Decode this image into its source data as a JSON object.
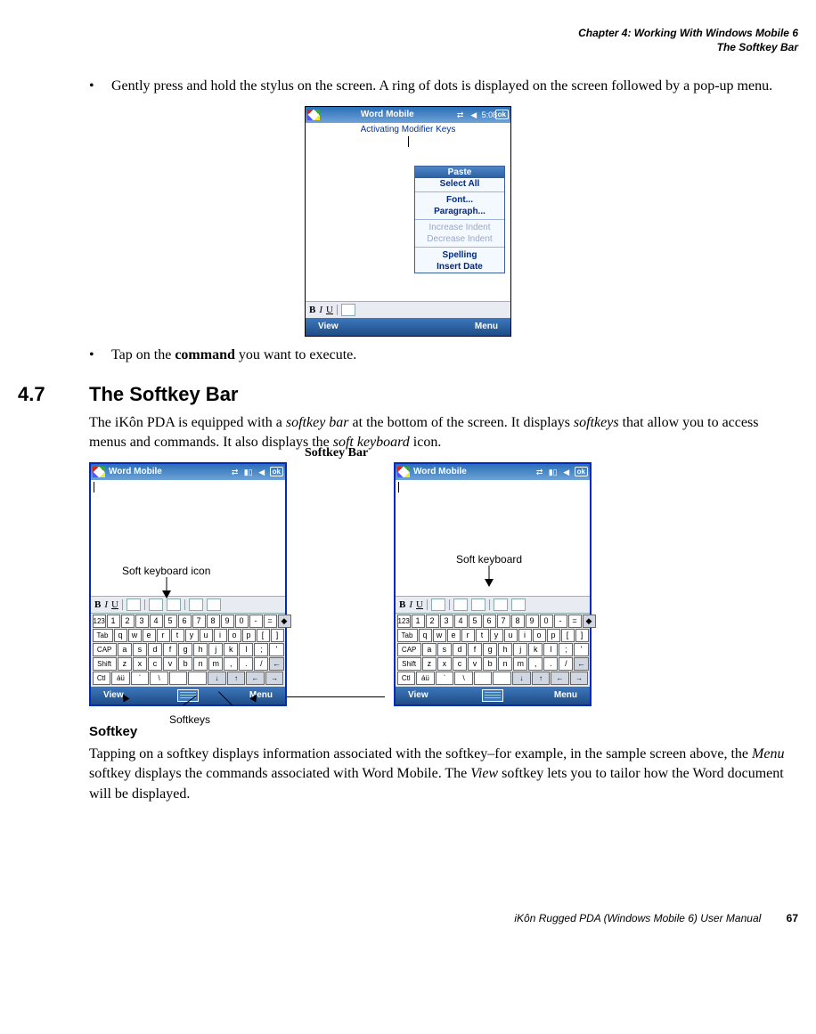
{
  "header": {
    "line1": "Chapter 4:  Working With Windows Mobile 6",
    "line2": "The Softkey Bar"
  },
  "bullets": {
    "b1": "Gently press and hold the stylus on the screen. A ring of dots is displayed on the screen followed by a pop-up menu.",
    "b2_pre": "Tap on the ",
    "b2_bold": "command",
    "b2_post": " you want to execute."
  },
  "screenshot1": {
    "title": "Word Mobile",
    "time": "5:08",
    "ok": "ok",
    "doc_text": "Activating Modifier Keys",
    "popup": {
      "paste": "Paste",
      "select_all": "Select All",
      "font": "Font...",
      "paragraph": "Paragraph...",
      "inc": "Increase Indent",
      "dec": "Decrease Indent",
      "spelling": "Spelling",
      "insert_date": "Insert Date"
    },
    "toolbar": {
      "b": "B",
      "i": "I",
      "u": "U"
    },
    "softbar": {
      "left": "View",
      "right": "Menu"
    }
  },
  "section": {
    "num": "4.7",
    "title": "The Softkey Bar",
    "p1a": "The iKôn PDA is equipped with a ",
    "p1b": "softkey bar",
    "p1c": " at the bottom of the screen. It displays ",
    "p1d": "softkeys",
    "p1e": " that allow you to access menus and commands. It also displays the ",
    "p1f": "soft keyboard",
    "p1g": " icon."
  },
  "screenshot2": {
    "title": "Word Mobile",
    "ok": "ok",
    "toolbar": {
      "b": "B",
      "i": "I",
      "u": "U"
    },
    "kb_rows": [
      [
        "123",
        "1",
        "2",
        "3",
        "4",
        "5",
        "6",
        "7",
        "8",
        "9",
        "0",
        "-",
        "=",
        "◆"
      ],
      [
        "Tab",
        "q",
        "w",
        "e",
        "r",
        "t",
        "y",
        "u",
        "i",
        "o",
        "p",
        "[",
        "]"
      ],
      [
        "CAP",
        "a",
        "s",
        "d",
        "f",
        "g",
        "h",
        "j",
        "k",
        "l",
        ";",
        "'"
      ],
      [
        "Shift",
        "z",
        "x",
        "c",
        "v",
        "b",
        "n",
        "m",
        ",",
        ".",
        "/",
        "←"
      ],
      [
        "Ctl",
        "áü",
        "`",
        "\\",
        " ",
        " ",
        "↓",
        "↑",
        "←",
        "→"
      ]
    ],
    "softbar": {
      "left": "View",
      "right": "Menu"
    }
  },
  "annotations": {
    "soft_kb_icon": "Soft keyboard icon",
    "soft_kb": "Soft keyboard",
    "softkey_bar": "Softkey Bar",
    "softkeys": "Softkeys"
  },
  "softkey_section": {
    "head": "Softkey",
    "p_a": "Tapping on a softkey displays information associated with the softkey–for example, in the sample screen above, the ",
    "p_b": "Menu",
    "p_c": " softkey displays the commands associated with Word Mobile. The ",
    "p_d": "View",
    "p_e": " softkey lets you to tailor how the Word document will be displayed."
  },
  "footer": {
    "text": "iKôn Rugged PDA (Windows Mobile 6) User Manual",
    "page": "67"
  }
}
